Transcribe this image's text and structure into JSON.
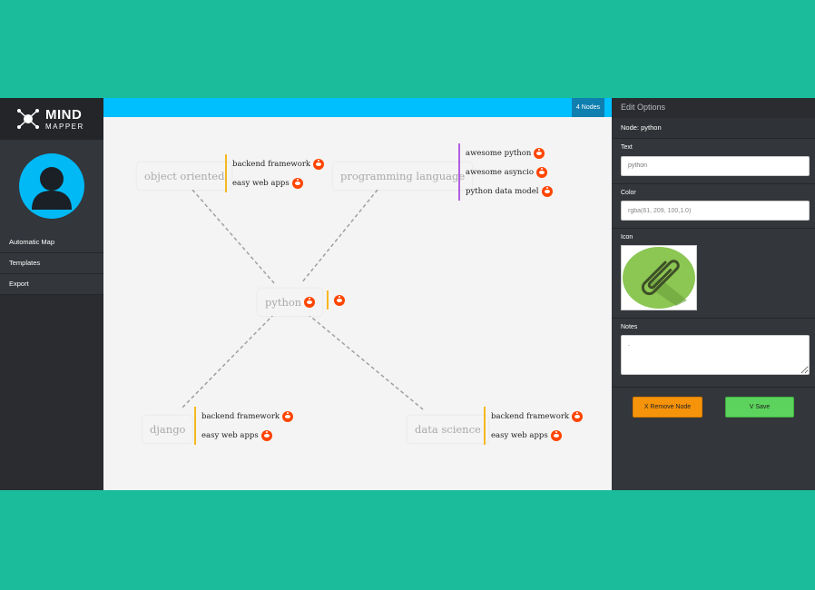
{
  "app": {
    "logo_line1": "MIND",
    "logo_line2": "MAPPER"
  },
  "sidebar": {
    "items": [
      {
        "label": "Automatic Map"
      },
      {
        "label": "Templates"
      },
      {
        "label": "Export"
      }
    ]
  },
  "topbar": {
    "node_count": "4 Nodes"
  },
  "map": {
    "center": {
      "label": "python",
      "icon": "reddit-icon"
    },
    "nodes": [
      {
        "label": "object oriented",
        "leaves": [
          "backend framework",
          "easy web apps"
        ]
      },
      {
        "label": "programming language",
        "leaves": [
          "awesome python",
          "awesome asyncio",
          "python data model"
        ]
      },
      {
        "label": "django",
        "leaves": [
          "backend framework",
          "easy web apps"
        ]
      },
      {
        "label": "data science",
        "leaves": [
          "backend framework",
          "easy web apps"
        ]
      }
    ],
    "leaf_icon": "reddit-icon",
    "colors": {
      "orange_bar": "#f5b820",
      "purple_bar": "#b25ee0",
      "link": "#a0a0a0"
    }
  },
  "panel": {
    "title": "Edit Options",
    "node_label": "Node: python",
    "text_label": "Text",
    "text_placeholder": "python",
    "color_label": "Color",
    "color_value": "rgba(61, 209, 100,1.0)",
    "icon_label": "Icon",
    "icon_name": "paperclip-icon",
    "notes_label": "Notes",
    "notes_value": ".",
    "remove_button": "X Remove Node",
    "save_button": "V Save"
  },
  "colors": {
    "background": "#1abc9c",
    "sidebar": "#2a2c30",
    "topbar": "#00bfff",
    "avatar": "#00b9f5",
    "remove": "#f5930b",
    "save": "#5cd35c"
  }
}
